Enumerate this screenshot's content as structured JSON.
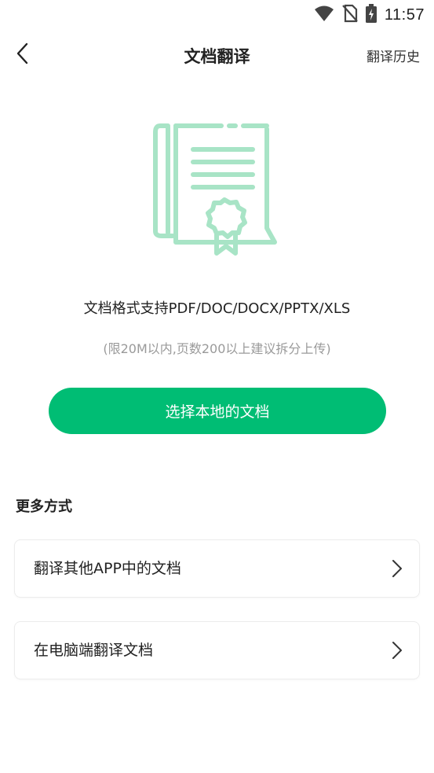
{
  "status_bar": {
    "time": "11:57",
    "icons": [
      "wifi-icon",
      "no-sim-icon",
      "battery-charging-icon"
    ]
  },
  "header": {
    "back_icon": "chevron-left-icon",
    "title": "文档翻译",
    "history_label": "翻译历史"
  },
  "main": {
    "illustration_icon": "document-certificate-icon",
    "formats_text": "文档格式支持PDF/DOC/DOCX/PPTX/XLS",
    "limit_text": "(限20M以内,页数200以上建议拆分上传)",
    "select_button_label": "选择本地的文档"
  },
  "more": {
    "section_title": "更多方式",
    "options": [
      {
        "label": "翻译其他APP中的文档",
        "icon": "chevron-right-icon"
      },
      {
        "label": "在电脑端翻译文档",
        "icon": "chevron-right-icon"
      }
    ]
  },
  "colors": {
    "accent": "#00bd74",
    "illustration": "#a8e4c6",
    "muted_text": "#9a9a9a"
  }
}
